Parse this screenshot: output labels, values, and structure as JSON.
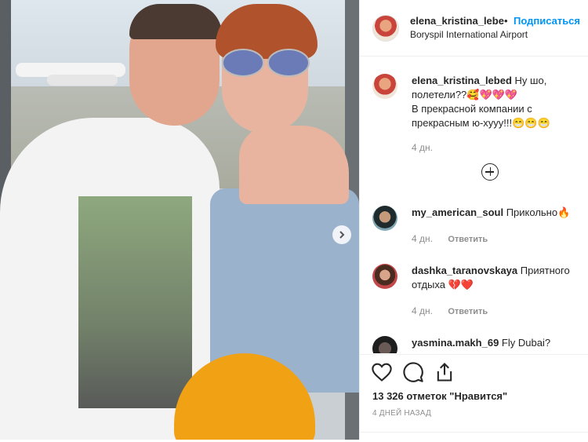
{
  "post": {
    "username": "elena_kristina_lebe",
    "follow_label": "Подписаться",
    "location": "Boryspil International Airport"
  },
  "caption": {
    "username": "elena_kristina_lebed",
    "line1": "Ну шо,",
    "line2": "полетели??🥰💖💖💖",
    "line3": "В прекрасной компании с",
    "line4": "прекрасным ю-хууу!!!😁😁😁",
    "time": "4 дн."
  },
  "comments": [
    {
      "username": "my_american_soul",
      "text": "Прикольно🔥",
      "time": "4 дн.",
      "reply": "Ответить"
    },
    {
      "username": "dashka_taranovskaya",
      "text": "Приятного",
      "text2": "отдыха",
      "time": "4 дн.",
      "reply": "Ответить"
    },
    {
      "username": "yasmina.makh_69",
      "text": "Fly Dubai?"
    }
  ],
  "likes": "13 326 отметок \"Нравится\"",
  "date": "4 ДНЕЙ НАЗАД",
  "icons": {
    "like": "heart-icon",
    "comment": "comment-icon",
    "share": "share-icon",
    "more_comments": "plus-circle-icon",
    "next": "chevron-right-icon"
  },
  "colors": {
    "accent": "#0095f6",
    "heart": "#ed4956"
  }
}
